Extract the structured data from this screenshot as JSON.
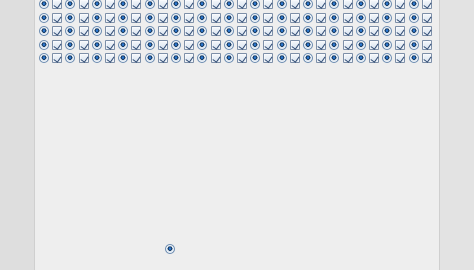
{
  "window": {
    "background": "#dedede",
    "panel_background": "#eeeeee",
    "accent_color": "#2b7ad6"
  },
  "controls_grid": {
    "rows": [
      [
        "radio",
        "check",
        "radio",
        "check",
        "radio",
        "check",
        "radio",
        "check",
        "radio",
        "check",
        "radio",
        "check",
        "radio",
        "check",
        "radio",
        "check",
        "radio",
        "check",
        "radio",
        "check",
        "radio",
        "check",
        "radio",
        "check",
        "radio",
        "check",
        "radio",
        "check",
        "radio",
        "check"
      ],
      [
        "radio",
        "check",
        "radio",
        "check",
        "radio",
        "check",
        "radio",
        "check",
        "radio",
        "check",
        "radio",
        "check",
        "radio",
        "check",
        "radio",
        "check",
        "radio",
        "check",
        "radio",
        "check",
        "radio",
        "check",
        "radio",
        "check",
        "radio",
        "check",
        "radio",
        "check",
        "radio",
        "check"
      ],
      [
        "radio",
        "check",
        "radio",
        "check",
        "radio",
        "check",
        "radio",
        "check",
        "radio",
        "check",
        "radio",
        "check",
        "radio",
        "check",
        "radio",
        "check",
        "radio",
        "check",
        "radio",
        "check",
        "radio",
        "check",
        "radio",
        "check",
        "radio",
        "check",
        "radio",
        "check",
        "radio",
        "check"
      ],
      [
        "radio",
        "check",
        "radio",
        "check",
        "radio",
        "check",
        "radio",
        "check",
        "radio",
        "check",
        "radio",
        "check",
        "radio",
        "check",
        "radio",
        "check",
        "radio",
        "check",
        "radio",
        "check",
        "radio",
        "check",
        "radio",
        "check",
        "radio",
        "check",
        "radio",
        "check",
        "radio",
        "check"
      ],
      [
        "radio",
        "check",
        "radio",
        "check",
        "radio",
        "check",
        "radio",
        "check",
        "radio",
        "check",
        "radio",
        "check",
        "radio",
        "check",
        "radio",
        "check",
        "radio",
        "check",
        "radio",
        "check",
        "radio",
        "check",
        "radio",
        "check",
        "radio",
        "check",
        "radio",
        "check",
        "radio",
        "check"
      ]
    ],
    "checked": true
  },
  "lone_radio": {
    "type": "radio",
    "selected": true
  }
}
